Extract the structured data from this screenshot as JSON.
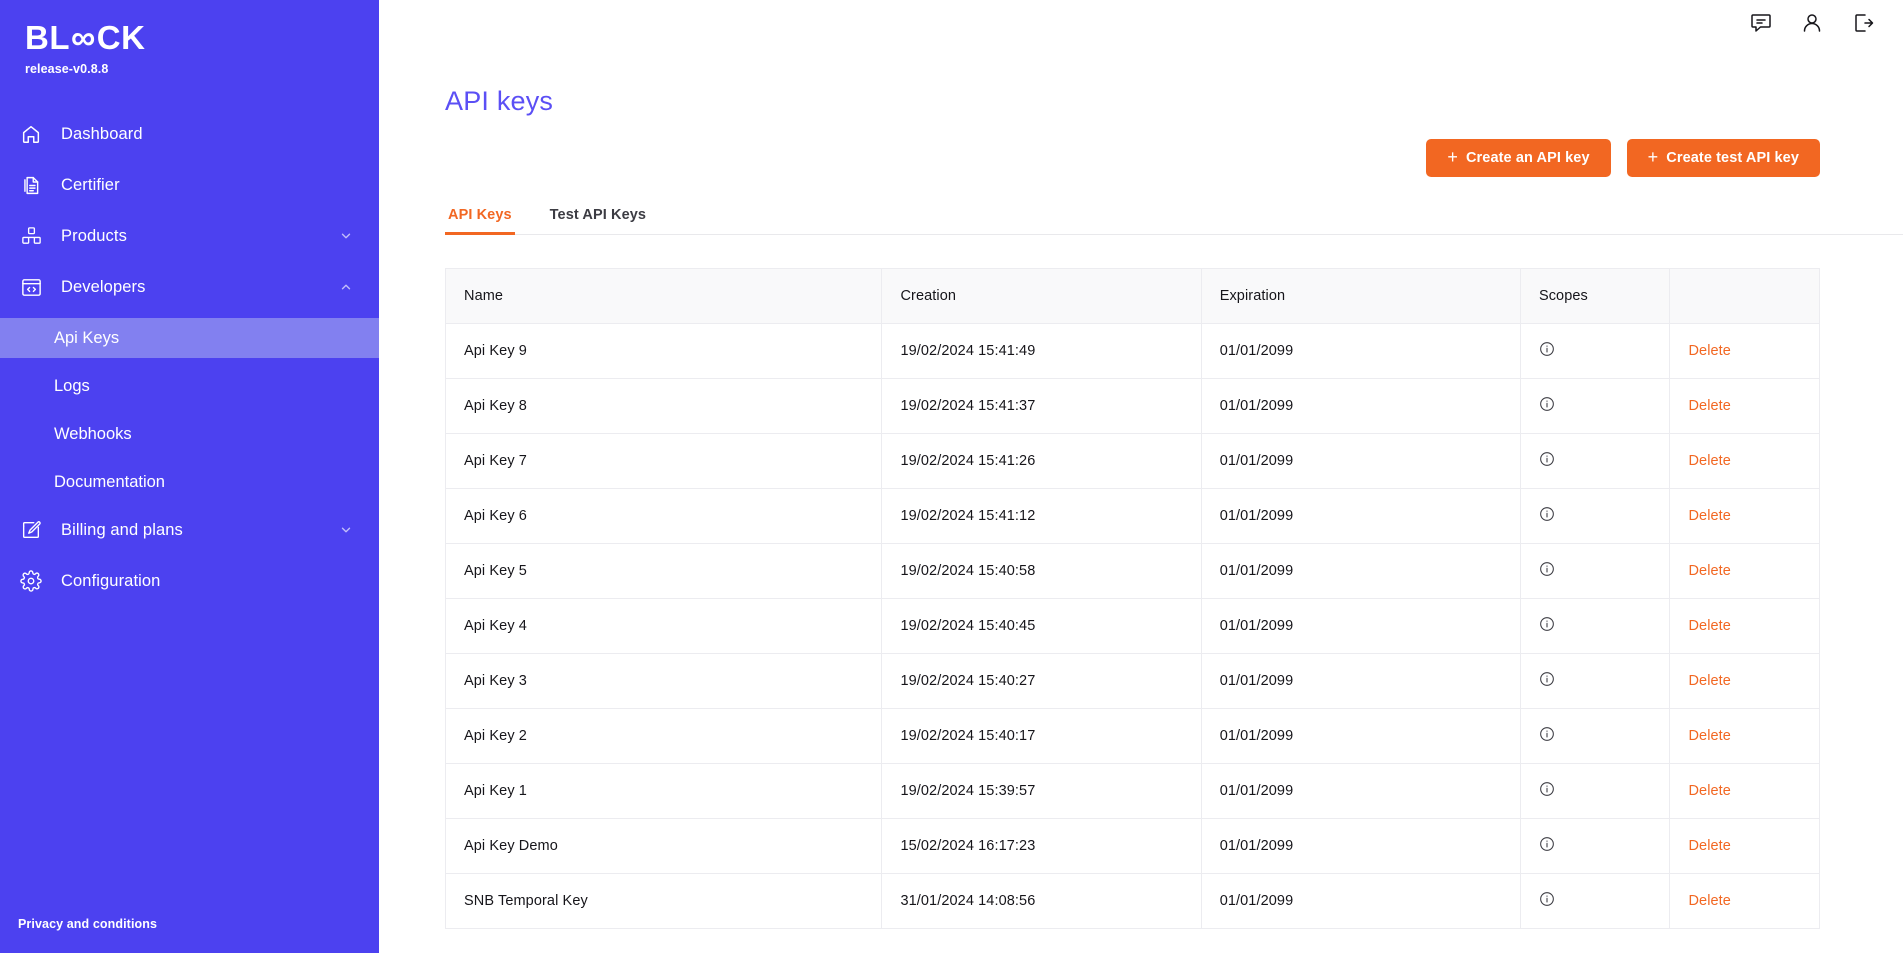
{
  "brand": {
    "name_part1": "BL",
    "name_infinity": "∞",
    "name_part2": "CK",
    "version": "release-v0.8.8"
  },
  "sidebar": {
    "items": [
      {
        "label": "Dashboard",
        "icon": "home-icon",
        "expandable": false
      },
      {
        "label": "Certifier",
        "icon": "document-icon",
        "expandable": false
      },
      {
        "label": "Products",
        "icon": "cubes-icon",
        "expandable": true,
        "state": "collapsed"
      },
      {
        "label": "Developers",
        "icon": "code-window-icon",
        "expandable": true,
        "state": "expanded"
      },
      {
        "label": "Billing and plans",
        "icon": "edit-square-icon",
        "expandable": true,
        "state": "collapsed"
      },
      {
        "label": "Configuration",
        "icon": "gear-icon",
        "expandable": false
      }
    ],
    "sub_items": [
      {
        "label": "Api Keys",
        "active": true
      },
      {
        "label": "Logs",
        "active": false
      },
      {
        "label": "Webhooks",
        "active": false
      },
      {
        "label": "Documentation",
        "active": false
      }
    ],
    "privacy_label": "Privacy and conditions"
  },
  "topbar": {
    "icons": [
      "chat-icon",
      "user-icon",
      "logout-icon"
    ]
  },
  "page": {
    "title": "API keys"
  },
  "actions": {
    "create_api_key": "Create an API key",
    "create_test_api_key": "Create test API key",
    "plus": "+"
  },
  "tabs": [
    {
      "label": "API Keys",
      "active": true
    },
    {
      "label": "Test API Keys",
      "active": false
    }
  ],
  "table": {
    "columns": [
      "Name",
      "Creation",
      "Expiration",
      "Scopes",
      ""
    ],
    "delete_label": "Delete",
    "rows": [
      {
        "name": "Api Key 9",
        "creation": "19/02/2024 15:41:49",
        "expiration": "01/01/2099"
      },
      {
        "name": "Api Key 8",
        "creation": "19/02/2024 15:41:37",
        "expiration": "01/01/2099"
      },
      {
        "name": "Api Key 7",
        "creation": "19/02/2024 15:41:26",
        "expiration": "01/01/2099"
      },
      {
        "name": "Api Key 6",
        "creation": "19/02/2024 15:41:12",
        "expiration": "01/01/2099"
      },
      {
        "name": "Api Key 5",
        "creation": "19/02/2024 15:40:58",
        "expiration": "01/01/2099"
      },
      {
        "name": "Api Key 4",
        "creation": "19/02/2024 15:40:45",
        "expiration": "01/01/2099"
      },
      {
        "name": "Api Key 3",
        "creation": "19/02/2024 15:40:27",
        "expiration": "01/01/2099"
      },
      {
        "name": "Api Key 2",
        "creation": "19/02/2024 15:40:17",
        "expiration": "01/01/2099"
      },
      {
        "name": "Api Key 1",
        "creation": "19/02/2024 15:39:57",
        "expiration": "01/01/2099"
      },
      {
        "name": "Api Key Demo",
        "creation": "15/02/2024 16:17:23",
        "expiration": "01/01/2099"
      },
      {
        "name": "SNB Temporal Key",
        "creation": "31/01/2024 14:08:56",
        "expiration": "01/01/2099"
      }
    ]
  },
  "colors": {
    "sidebar": "#4c41f0",
    "sidebar_active": "#8280f0",
    "accent_orange": "#f26722",
    "title_purple": "#5b4ff5"
  }
}
